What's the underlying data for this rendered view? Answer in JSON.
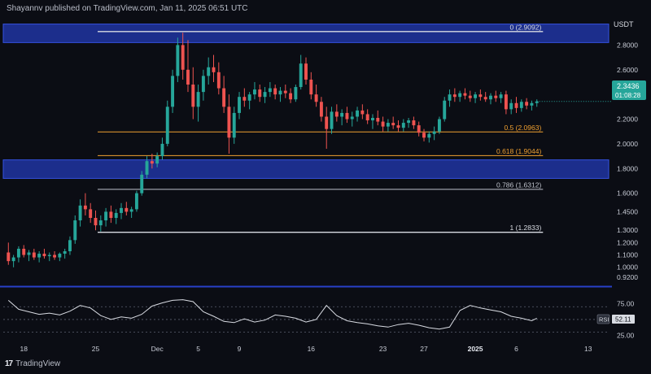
{
  "header": {
    "published": "Shayannv published on TradingView.com, Jan 11, 2025 06:51 UTC",
    "currency": "USDT"
  },
  "footer": {
    "brand": "TradingView",
    "brand_mark": "17"
  },
  "price_badge": {
    "price": "2.3436",
    "countdown": "01:08:28",
    "color": "#26a69a"
  },
  "rsi_badge": {
    "label": "RSI",
    "value": "52.11"
  },
  "colors": {
    "up": "#26a69a",
    "down": "#ef5350",
    "zone": "#1c2e8c",
    "fib_white": "#d8dbe2",
    "fib_orange": "#f0a030",
    "fib_gray": "#bfc3cc",
    "rsi": "#d8dbe2",
    "blue_line": "#2840c8"
  },
  "chart_data": [
    {
      "type": "candlestick",
      "title": "",
      "ylabel": "",
      "ylim": [
        0.86,
        3.02
      ],
      "y_ticks": [
        "2.8000",
        "2.6000",
        "2.4000",
        "2.2000",
        "2.0000",
        "1.8000",
        "1.6000",
        "1.4500",
        "1.3000",
        "1.2000",
        "1.1000",
        "1.0000",
        "0.9200"
      ],
      "y_tick_values": [
        2.8,
        2.6,
        2.4,
        2.2,
        2.0,
        1.8,
        1.6,
        1.45,
        1.3,
        1.2,
        1.1,
        1.0,
        0.92
      ],
      "x_ticks": [
        "18",
        "25",
        "Dec",
        "5",
        "9",
        "16",
        "23",
        "27",
        "2025",
        "6",
        "13"
      ],
      "x_tick_days": [
        0,
        7,
        13,
        17,
        21,
        28,
        35,
        39,
        44,
        48,
        55
      ],
      "x_start": "2024-11-18",
      "supply_zone": [
        2.82,
        2.97
      ],
      "demand_zone": [
        1.72,
        1.87
      ],
      "fib_levels": [
        {
          "label": "0 (2.9092)",
          "price": 2.9092,
          "style": "white"
        },
        {
          "label": "0.5 (2.0963)",
          "price": 2.0963,
          "style": "orange"
        },
        {
          "label": "0.618 (1.9044)",
          "price": 1.9044,
          "style": "orange"
        },
        {
          "label": "0.786 (1.6312)",
          "price": 1.6312,
          "style": "gray"
        },
        {
          "label": "1 (1.2833)",
          "price": 1.2833,
          "style": "white"
        }
      ],
      "ohlc": [
        {
          "d": -1.5,
          "o": 1.12,
          "h": 1.2,
          "l": 1.02,
          "c": 1.05
        },
        {
          "d": -1.0,
          "o": 1.05,
          "h": 1.1,
          "l": 1.0,
          "c": 1.08
        },
        {
          "d": -0.5,
          "o": 1.08,
          "h": 1.17,
          "l": 1.04,
          "c": 1.15
        },
        {
          "d": 0.0,
          "o": 1.15,
          "h": 1.18,
          "l": 1.08,
          "c": 1.1
        },
        {
          "d": 0.5,
          "o": 1.1,
          "h": 1.14,
          "l": 1.05,
          "c": 1.12
        },
        {
          "d": 1.0,
          "o": 1.12,
          "h": 1.15,
          "l": 1.06,
          "c": 1.08
        },
        {
          "d": 1.5,
          "o": 1.08,
          "h": 1.13,
          "l": 1.04,
          "c": 1.11
        },
        {
          "d": 2.0,
          "o": 1.11,
          "h": 1.15,
          "l": 1.07,
          "c": 1.09
        },
        {
          "d": 2.5,
          "o": 1.09,
          "h": 1.12,
          "l": 1.05,
          "c": 1.1
        },
        {
          "d": 3.0,
          "o": 1.1,
          "h": 1.13,
          "l": 1.06,
          "c": 1.08
        },
        {
          "d": 3.5,
          "o": 1.08,
          "h": 1.12,
          "l": 1.05,
          "c": 1.11
        },
        {
          "d": 4.0,
          "o": 1.11,
          "h": 1.15,
          "l": 1.07,
          "c": 1.13
        },
        {
          "d": 4.5,
          "o": 1.13,
          "h": 1.25,
          "l": 1.1,
          "c": 1.22
        },
        {
          "d": 5.0,
          "o": 1.22,
          "h": 1.42,
          "l": 1.19,
          "c": 1.38
        },
        {
          "d": 5.5,
          "o": 1.38,
          "h": 1.55,
          "l": 1.33,
          "c": 1.5
        },
        {
          "d": 6.0,
          "o": 1.5,
          "h": 1.6,
          "l": 1.42,
          "c": 1.47
        },
        {
          "d": 6.5,
          "o": 1.47,
          "h": 1.52,
          "l": 1.36,
          "c": 1.4
        },
        {
          "d": 7.0,
          "o": 1.4,
          "h": 1.46,
          "l": 1.3,
          "c": 1.34
        },
        {
          "d": 7.5,
          "o": 1.34,
          "h": 1.42,
          "l": 1.29,
          "c": 1.38
        },
        {
          "d": 8.0,
          "o": 1.38,
          "h": 1.48,
          "l": 1.33,
          "c": 1.45
        },
        {
          "d": 8.5,
          "o": 1.45,
          "h": 1.5,
          "l": 1.36,
          "c": 1.4
        },
        {
          "d": 9.0,
          "o": 1.4,
          "h": 1.47,
          "l": 1.35,
          "c": 1.44
        },
        {
          "d": 9.5,
          "o": 1.44,
          "h": 1.52,
          "l": 1.39,
          "c": 1.48
        },
        {
          "d": 10.0,
          "o": 1.48,
          "h": 1.53,
          "l": 1.42,
          "c": 1.45
        },
        {
          "d": 10.5,
          "o": 1.45,
          "h": 1.49,
          "l": 1.4,
          "c": 1.47
        },
        {
          "d": 11.0,
          "o": 1.47,
          "h": 1.62,
          "l": 1.45,
          "c": 1.6
        },
        {
          "d": 11.5,
          "o": 1.6,
          "h": 1.78,
          "l": 1.58,
          "c": 1.75
        },
        {
          "d": 12.0,
          "o": 1.75,
          "h": 1.9,
          "l": 1.72,
          "c": 1.86
        },
        {
          "d": 12.5,
          "o": 1.86,
          "h": 1.92,
          "l": 1.8,
          "c": 1.84
        },
        {
          "d": 13.0,
          "o": 1.84,
          "h": 1.93,
          "l": 1.81,
          "c": 1.9
        },
        {
          "d": 13.5,
          "o": 1.9,
          "h": 2.05,
          "l": 1.87,
          "c": 2.0
        },
        {
          "d": 14.0,
          "o": 2.0,
          "h": 2.35,
          "l": 1.98,
          "c": 2.3
        },
        {
          "d": 14.5,
          "o": 2.3,
          "h": 2.6,
          "l": 2.25,
          "c": 2.55
        },
        {
          "d": 15.0,
          "o": 2.55,
          "h": 2.86,
          "l": 2.5,
          "c": 2.8
        },
        {
          "d": 15.5,
          "o": 2.8,
          "h": 2.9,
          "l": 2.52,
          "c": 2.6
        },
        {
          "d": 16.0,
          "o": 2.6,
          "h": 2.84,
          "l": 2.42,
          "c": 2.48
        },
        {
          "d": 16.5,
          "o": 2.48,
          "h": 2.62,
          "l": 2.2,
          "c": 2.3
        },
        {
          "d": 17.0,
          "o": 2.3,
          "h": 2.48,
          "l": 2.18,
          "c": 2.42
        },
        {
          "d": 17.5,
          "o": 2.42,
          "h": 2.6,
          "l": 2.35,
          "c": 2.55
        },
        {
          "d": 18.0,
          "o": 2.55,
          "h": 2.7,
          "l": 2.48,
          "c": 2.62
        },
        {
          "d": 18.5,
          "o": 2.62,
          "h": 2.72,
          "l": 2.5,
          "c": 2.58
        },
        {
          "d": 19.0,
          "o": 2.58,
          "h": 2.66,
          "l": 2.4,
          "c": 2.45
        },
        {
          "d": 19.5,
          "o": 2.45,
          "h": 2.55,
          "l": 2.25,
          "c": 2.3
        },
        {
          "d": 20.0,
          "o": 2.3,
          "h": 2.4,
          "l": 1.92,
          "c": 2.05
        },
        {
          "d": 20.5,
          "o": 2.05,
          "h": 2.3,
          "l": 2.0,
          "c": 2.25
        },
        {
          "d": 21.0,
          "o": 2.25,
          "h": 2.42,
          "l": 2.2,
          "c": 2.38
        },
        {
          "d": 21.5,
          "o": 2.38,
          "h": 2.45,
          "l": 2.3,
          "c": 2.35
        },
        {
          "d": 22.0,
          "o": 2.35,
          "h": 2.42,
          "l": 2.28,
          "c": 2.4
        },
        {
          "d": 22.5,
          "o": 2.4,
          "h": 2.5,
          "l": 2.36,
          "c": 2.44
        },
        {
          "d": 23.0,
          "o": 2.44,
          "h": 2.48,
          "l": 2.34,
          "c": 2.38
        },
        {
          "d": 23.5,
          "o": 2.38,
          "h": 2.46,
          "l": 2.33,
          "c": 2.42
        },
        {
          "d": 24.0,
          "o": 2.42,
          "h": 2.5,
          "l": 2.38,
          "c": 2.45
        },
        {
          "d": 24.5,
          "o": 2.45,
          "h": 2.48,
          "l": 2.36,
          "c": 2.4
        },
        {
          "d": 25.0,
          "o": 2.4,
          "h": 2.46,
          "l": 2.34,
          "c": 2.43
        },
        {
          "d": 25.5,
          "o": 2.43,
          "h": 2.48,
          "l": 2.37,
          "c": 2.41
        },
        {
          "d": 26.0,
          "o": 2.41,
          "h": 2.45,
          "l": 2.33,
          "c": 2.36
        },
        {
          "d": 26.5,
          "o": 2.36,
          "h": 2.48,
          "l": 2.34,
          "c": 2.46
        },
        {
          "d": 27.0,
          "o": 2.46,
          "h": 2.72,
          "l": 2.44,
          "c": 2.65
        },
        {
          "d": 27.5,
          "o": 2.65,
          "h": 2.7,
          "l": 2.48,
          "c": 2.52
        },
        {
          "d": 28.0,
          "o": 2.52,
          "h": 2.58,
          "l": 2.36,
          "c": 2.4
        },
        {
          "d": 28.5,
          "o": 2.4,
          "h": 2.48,
          "l": 2.3,
          "c": 2.34
        },
        {
          "d": 29.0,
          "o": 2.34,
          "h": 2.38,
          "l": 2.18,
          "c": 2.22
        },
        {
          "d": 29.5,
          "o": 2.22,
          "h": 2.3,
          "l": 1.96,
          "c": 2.12
        },
        {
          "d": 30.0,
          "o": 2.12,
          "h": 2.3,
          "l": 2.08,
          "c": 2.26
        },
        {
          "d": 30.5,
          "o": 2.26,
          "h": 2.32,
          "l": 2.18,
          "c": 2.22
        },
        {
          "d": 31.0,
          "o": 2.22,
          "h": 2.28,
          "l": 2.15,
          "c": 2.25
        },
        {
          "d": 31.5,
          "o": 2.25,
          "h": 2.3,
          "l": 2.17,
          "c": 2.2
        },
        {
          "d": 32.0,
          "o": 2.2,
          "h": 2.26,
          "l": 2.14,
          "c": 2.22
        },
        {
          "d": 32.5,
          "o": 2.22,
          "h": 2.3,
          "l": 2.18,
          "c": 2.27
        },
        {
          "d": 33.0,
          "o": 2.27,
          "h": 2.32,
          "l": 2.2,
          "c": 2.24
        },
        {
          "d": 33.5,
          "o": 2.24,
          "h": 2.28,
          "l": 2.16,
          "c": 2.19
        },
        {
          "d": 34.0,
          "o": 2.19,
          "h": 2.24,
          "l": 2.12,
          "c": 2.21
        },
        {
          "d": 34.5,
          "o": 2.21,
          "h": 2.27,
          "l": 2.15,
          "c": 2.18
        },
        {
          "d": 35.0,
          "o": 2.18,
          "h": 2.22,
          "l": 2.1,
          "c": 2.14
        },
        {
          "d": 35.5,
          "o": 2.14,
          "h": 2.2,
          "l": 2.1,
          "c": 2.17
        },
        {
          "d": 36.0,
          "o": 2.17,
          "h": 2.22,
          "l": 2.12,
          "c": 2.15
        },
        {
          "d": 36.5,
          "o": 2.15,
          "h": 2.19,
          "l": 2.1,
          "c": 2.13
        },
        {
          "d": 37.0,
          "o": 2.13,
          "h": 2.2,
          "l": 2.1,
          "c": 2.17
        },
        {
          "d": 37.5,
          "o": 2.17,
          "h": 2.21,
          "l": 2.13,
          "c": 2.19
        },
        {
          "d": 38.0,
          "o": 2.19,
          "h": 2.22,
          "l": 2.12,
          "c": 2.15
        },
        {
          "d": 38.5,
          "o": 2.15,
          "h": 2.18,
          "l": 2.06,
          "c": 2.09
        },
        {
          "d": 39.0,
          "o": 2.09,
          "h": 2.12,
          "l": 2.02,
          "c": 2.05
        },
        {
          "d": 39.5,
          "o": 2.05,
          "h": 2.1,
          "l": 2.01,
          "c": 2.08
        },
        {
          "d": 40.0,
          "o": 2.08,
          "h": 2.14,
          "l": 2.03,
          "c": 2.1
        },
        {
          "d": 40.5,
          "o": 2.1,
          "h": 2.22,
          "l": 2.08,
          "c": 2.2
        },
        {
          "d": 41.0,
          "o": 2.2,
          "h": 2.38,
          "l": 2.18,
          "c": 2.35
        },
        {
          "d": 41.5,
          "o": 2.35,
          "h": 2.44,
          "l": 2.3,
          "c": 2.4
        },
        {
          "d": 42.0,
          "o": 2.4,
          "h": 2.45,
          "l": 2.34,
          "c": 2.38
        },
        {
          "d": 42.5,
          "o": 2.38,
          "h": 2.43,
          "l": 2.34,
          "c": 2.41
        },
        {
          "d": 43.0,
          "o": 2.41,
          "h": 2.45,
          "l": 2.36,
          "c": 2.39
        },
        {
          "d": 43.5,
          "o": 2.39,
          "h": 2.43,
          "l": 2.34,
          "c": 2.37
        },
        {
          "d": 44.0,
          "o": 2.37,
          "h": 2.42,
          "l": 2.33,
          "c": 2.4
        },
        {
          "d": 44.5,
          "o": 2.4,
          "h": 2.44,
          "l": 2.35,
          "c": 2.38
        },
        {
          "d": 45.0,
          "o": 2.38,
          "h": 2.42,
          "l": 2.34,
          "c": 2.36
        },
        {
          "d": 45.5,
          "o": 2.36,
          "h": 2.41,
          "l": 2.32,
          "c": 2.39
        },
        {
          "d": 46.0,
          "o": 2.39,
          "h": 2.43,
          "l": 2.34,
          "c": 2.37
        },
        {
          "d": 46.5,
          "o": 2.37,
          "h": 2.42,
          "l": 2.33,
          "c": 2.4
        },
        {
          "d": 47.0,
          "o": 2.4,
          "h": 2.43,
          "l": 2.24,
          "c": 2.28
        },
        {
          "d": 47.5,
          "o": 2.28,
          "h": 2.36,
          "l": 2.24,
          "c": 2.33
        },
        {
          "d": 48.0,
          "o": 2.33,
          "h": 2.38,
          "l": 2.25,
          "c": 2.29
        },
        {
          "d": 48.5,
          "o": 2.29,
          "h": 2.36,
          "l": 2.26,
          "c": 2.34
        },
        {
          "d": 49.0,
          "o": 2.34,
          "h": 2.37,
          "l": 2.28,
          "c": 2.31
        },
        {
          "d": 49.5,
          "o": 2.31,
          "h": 2.35,
          "l": 2.27,
          "c": 2.33
        },
        {
          "d": 50.0,
          "o": 2.33,
          "h": 2.36,
          "l": 2.3,
          "c": 2.3436
        }
      ]
    },
    {
      "type": "line",
      "title": "",
      "ylabel": "",
      "ylim": [
        18,
        92
      ],
      "y_ticks": [
        "75.00",
        "25.00"
      ],
      "y_tick_values": [
        75,
        25
      ],
      "bands": [
        70,
        50,
        30
      ],
      "series": [
        {
          "name": "RSI",
          "x": [
            -1.5,
            -0.5,
            0.5,
            1.5,
            2.5,
            3.5,
            4.5,
            5.5,
            6.5,
            7.5,
            8.5,
            9.5,
            10.5,
            11.5,
            12.5,
            13.5,
            14.5,
            15.5,
            16.5,
            17.5,
            18.5,
            19.5,
            20.5,
            21.5,
            22.5,
            23.5,
            24.5,
            25.5,
            26.5,
            27.5,
            28.5,
            29.5,
            30.5,
            31.5,
            32.5,
            33.5,
            34.5,
            35.5,
            36.5,
            37.5,
            38.5,
            39.5,
            40.5,
            41.5,
            42.5,
            43.5,
            44.5,
            45.5,
            46.5,
            47.5,
            48.5,
            49.5,
            50.0
          ],
          "values": [
            80,
            66,
            62,
            58,
            60,
            57,
            63,
            72,
            68,
            56,
            50,
            54,
            52,
            58,
            71,
            76,
            80,
            81,
            78,
            62,
            55,
            47,
            45,
            51,
            46,
            49,
            57,
            55,
            52,
            46,
            50,
            72,
            56,
            48,
            45,
            43,
            40,
            38,
            42,
            44,
            41,
            37,
            35,
            38,
            64,
            72,
            68,
            65,
            62,
            55,
            52,
            48,
            52
          ]
        }
      ]
    }
  ]
}
